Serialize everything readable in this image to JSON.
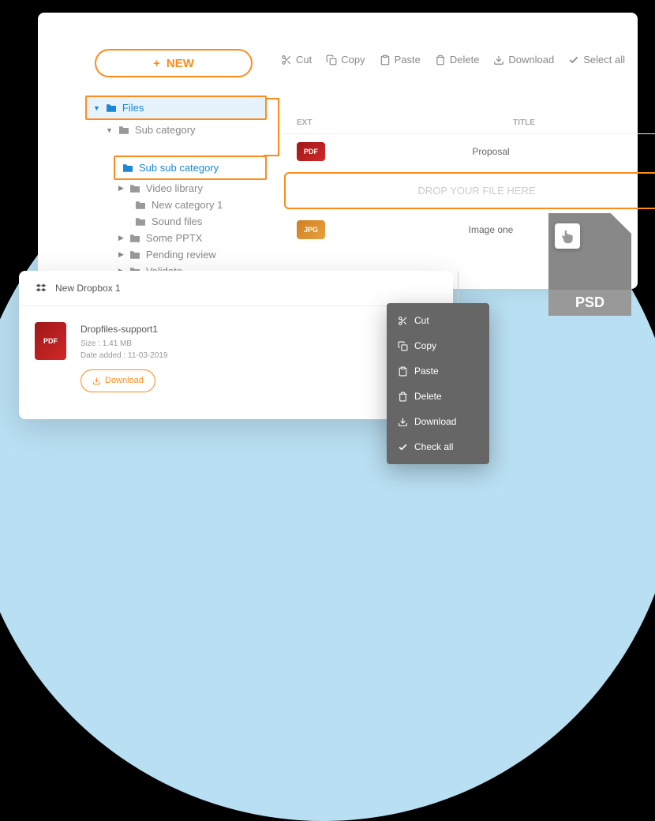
{
  "new_button": "NEW",
  "toolbar": {
    "cut": "Cut",
    "copy": "Copy",
    "paste": "Paste",
    "delete": "Delete",
    "download": "Download",
    "select_all": "Select all"
  },
  "tree": {
    "root": "Files",
    "sub_category": "Sub category",
    "sub_sub_category": "Sub sub category",
    "items": [
      "Video library",
      "New category 1",
      "Sound files",
      "Some PPTX",
      "Pending review",
      "Validate"
    ]
  },
  "file_list": {
    "headers": {
      "ext": "EXT",
      "title": "TITLE"
    },
    "rows": [
      {
        "ext": "PDF",
        "title": "Proposal"
      },
      {
        "ext": "JPG",
        "title": "Image one"
      }
    ],
    "drop_hint": "DROP YOUR FILE HERE"
  },
  "dropbox_card": {
    "title": "New Dropbox 1",
    "file": {
      "badge": "PDF",
      "name": "Dropfiles-support1",
      "size_label": "Size : 1.41 MB",
      "date_label": "Date added : 11-03-2019",
      "download": "Download"
    }
  },
  "context_menu": {
    "cut": "Cut",
    "copy": "Copy",
    "paste": "Paste",
    "delete": "Delete",
    "download": "Download",
    "check_all": "Check all"
  },
  "psd_label": "PSD"
}
